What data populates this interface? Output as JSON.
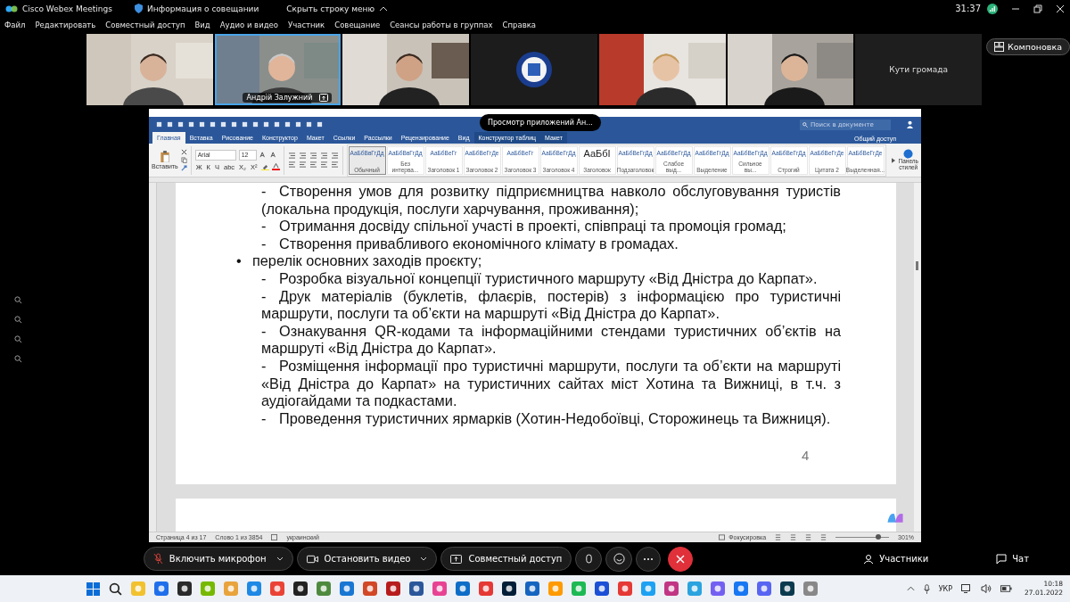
{
  "app": {
    "title": "Cisco Webex Meetings",
    "meeting_info": "Информация о совещании",
    "hide_menu": "Скрыть строку меню",
    "timer": "31:37"
  },
  "menu": [
    "Файл",
    "Редактировать",
    "Совместный доступ",
    "Вид",
    "Аудио и видео",
    "Участник",
    "Совещание",
    "Сеансы работы в группах",
    "Справка"
  ],
  "participants": [
    {
      "kind": "picture",
      "active": false
    },
    {
      "kind": "picture",
      "name": "Андрій Залужний",
      "active": true
    },
    {
      "kind": "picture",
      "active": false
    },
    {
      "kind": "picture",
      "active": false
    },
    {
      "kind": "picture",
      "active": false
    },
    {
      "kind": "picture",
      "active": false
    },
    {
      "kind": "name",
      "name": "Кути громада"
    }
  ],
  "layout_button": "Компоновка",
  "word": {
    "tooltip": "Просмотр приложений Ан...",
    "search_placeholder": "Поиск в документе",
    "share": "Общий доступ",
    "tabs": [
      {
        "label": "Главная",
        "selected": true
      },
      {
        "label": "Вставка",
        "selected": false
      },
      {
        "label": "Рисование",
        "selected": false
      },
      {
        "label": "Конструктор",
        "selected": false
      },
      {
        "label": "Макет",
        "selected": false
      },
      {
        "label": "Ссылки",
        "selected": false
      },
      {
        "label": "Рассылки",
        "selected": false
      },
      {
        "label": "Рецензирование",
        "selected": false
      },
      {
        "label": "Вид",
        "selected": false
      },
      {
        "label": "Конструктор таблиц",
        "selected": false,
        "contextual": true
      },
      {
        "label": "Макет",
        "selected": false,
        "contextual": true
      }
    ],
    "paste": "Вставить",
    "font": "Arial",
    "size": "12",
    "format_buttons": [
      "Ж",
      "К",
      "Ч",
      "abc",
      "X₂",
      "X²"
    ],
    "styles": [
      {
        "sample": "АаБбВвГгДд",
        "name": "Обычный",
        "selected": true
      },
      {
        "sample": "АаБбВвГгДд",
        "name": "Без интерва...",
        "selected": false
      },
      {
        "sample": "АаБбВеГг",
        "name": "Заголовок 1",
        "selected": false
      },
      {
        "sample": "АаБбВеГгДе",
        "name": "Заголовок 2",
        "selected": false
      },
      {
        "sample": "АаБбВеГг",
        "name": "Заголовок 3",
        "selected": false
      },
      {
        "sample": "АаБбВеГгДд",
        "name": "Заголовок 4",
        "selected": false
      },
      {
        "sample": "АаБбІ",
        "name": "Заголовок",
        "selected": false,
        "large": true
      },
      {
        "sample": "АаБбВеГгДд",
        "name": "Подзаголовок",
        "selected": false
      },
      {
        "sample": "АаБбВеГгДд",
        "name": "Слабое выд...",
        "selected": false
      },
      {
        "sample": "АаБбВеГгДд",
        "name": "Выделение",
        "selected": false
      },
      {
        "sample": "АаБбВеГгДд",
        "name": "Сильное вы...",
        "selected": false
      },
      {
        "sample": "АаБбВеГгДд",
        "name": "Строгий",
        "selected": false
      },
      {
        "sample": "АаБбВеГгДе",
        "name": "Цитата 2",
        "selected": false
      },
      {
        "sample": "АаБбВеГгДе",
        "name": "Выделенная...",
        "selected": false
      }
    ],
    "styles_pane": "Панель стилей",
    "paragraphs": [
      {
        "kind": "dash",
        "marker": "-",
        "text": "Створення умов для розвитку підприємництва навколо обслуговування туристів (локальна продукція, послуги харчування, проживання);"
      },
      {
        "kind": "dash",
        "marker": "-",
        "text": "Отримання досвіду спільної участі в проекті, співпраці та промоція громад;"
      },
      {
        "kind": "dash",
        "marker": "-",
        "text": "Створення привабливого економічного клімату в громадах."
      },
      {
        "kind": "bullet",
        "marker": "•",
        "text": "перелік основних заходів проєкту;"
      },
      {
        "kind": "dash",
        "marker": "-",
        "text": "Розробка візуальної концепції туристичного маршруту «Від Дністра до Карпат»."
      },
      {
        "kind": "dash",
        "marker": "-",
        "text": "Друк матеріалів (буклетів, флаєрів, постерів) з інформацією про туристичні маршрути, послуги та об’єкти на маршруті «Від Дністра до Карпат»."
      },
      {
        "kind": "dash",
        "marker": "-",
        "text": "Ознакування QR-кодами та інформаційними стендами туристичних об’єктів на маршруті «Від Дністра до Карпат»."
      },
      {
        "kind": "dash",
        "marker": "-",
        "text": "Розміщення інформації про туристичні маршрути, послуги та об’єкти на маршруті «Від Дністра до Карпат» на туристичних сайтах міст Хотина та Вижниці, в т.ч. з аудіогайдами та подкастами."
      },
      {
        "kind": "dash",
        "marker": "-",
        "text": "Проведення туристичних ярмарків (Хотин-Недобоївці, Сторожинець та Вижниця)."
      }
    ],
    "page_number": "4",
    "status": {
      "page": "Страница 4 из 17",
      "words": "Слово 1 из 3854",
      "language": "украинский",
      "focus": "Фокусировка",
      "zoom": "301%",
      "level": 0.8
    }
  },
  "controls": {
    "mic": {
      "label": "Включить микрофон",
      "muted": true
    },
    "video": "Остановить видео",
    "share": "Совместный доступ",
    "participants": "Участники",
    "chat": "Чат"
  },
  "taskbar": {
    "language": "УКР",
    "time": "10:18",
    "date": "27.01.2022"
  }
}
